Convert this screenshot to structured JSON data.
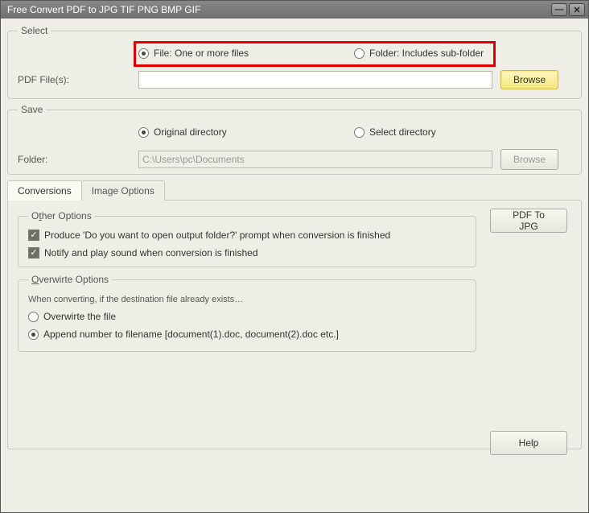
{
  "window": {
    "title": "Free Convert PDF to JPG TIF PNG BMP GIF"
  },
  "select": {
    "legend": "Select",
    "file_radio": "File:  One or more files",
    "folder_radio": "Folder: Includes sub-folder",
    "pdf_label": "PDF File(s):",
    "pdf_value": "",
    "browse": "Browse"
  },
  "save": {
    "legend": "Save",
    "orig_radio": "Original directory",
    "sel_radio": "Select directory",
    "folder_label": "Folder:",
    "folder_value": "C:\\Users\\pc\\Documents",
    "browse": "Browse"
  },
  "tabs": {
    "conversions": "Conversions",
    "imageopts": "Image Options"
  },
  "other": {
    "legend_pre": "O",
    "legend_u": "t",
    "legend_post": "her Options",
    "op1": "Produce 'Do you want to open output folder?' prompt when conversion is finished",
    "op2": "Notify and play sound when conversion is finished"
  },
  "overwrite": {
    "legend_pre": "",
    "legend_u": "O",
    "legend_post": "verwirte Options",
    "hint": "When converting, if the destination file already exists…",
    "r1": "Overwirte the file",
    "r2": "Append number to filename  [document(1).doc, document(2).doc etc.]"
  },
  "buttons": {
    "pdf2jpg": "PDF To JPG",
    "help": "Help"
  }
}
